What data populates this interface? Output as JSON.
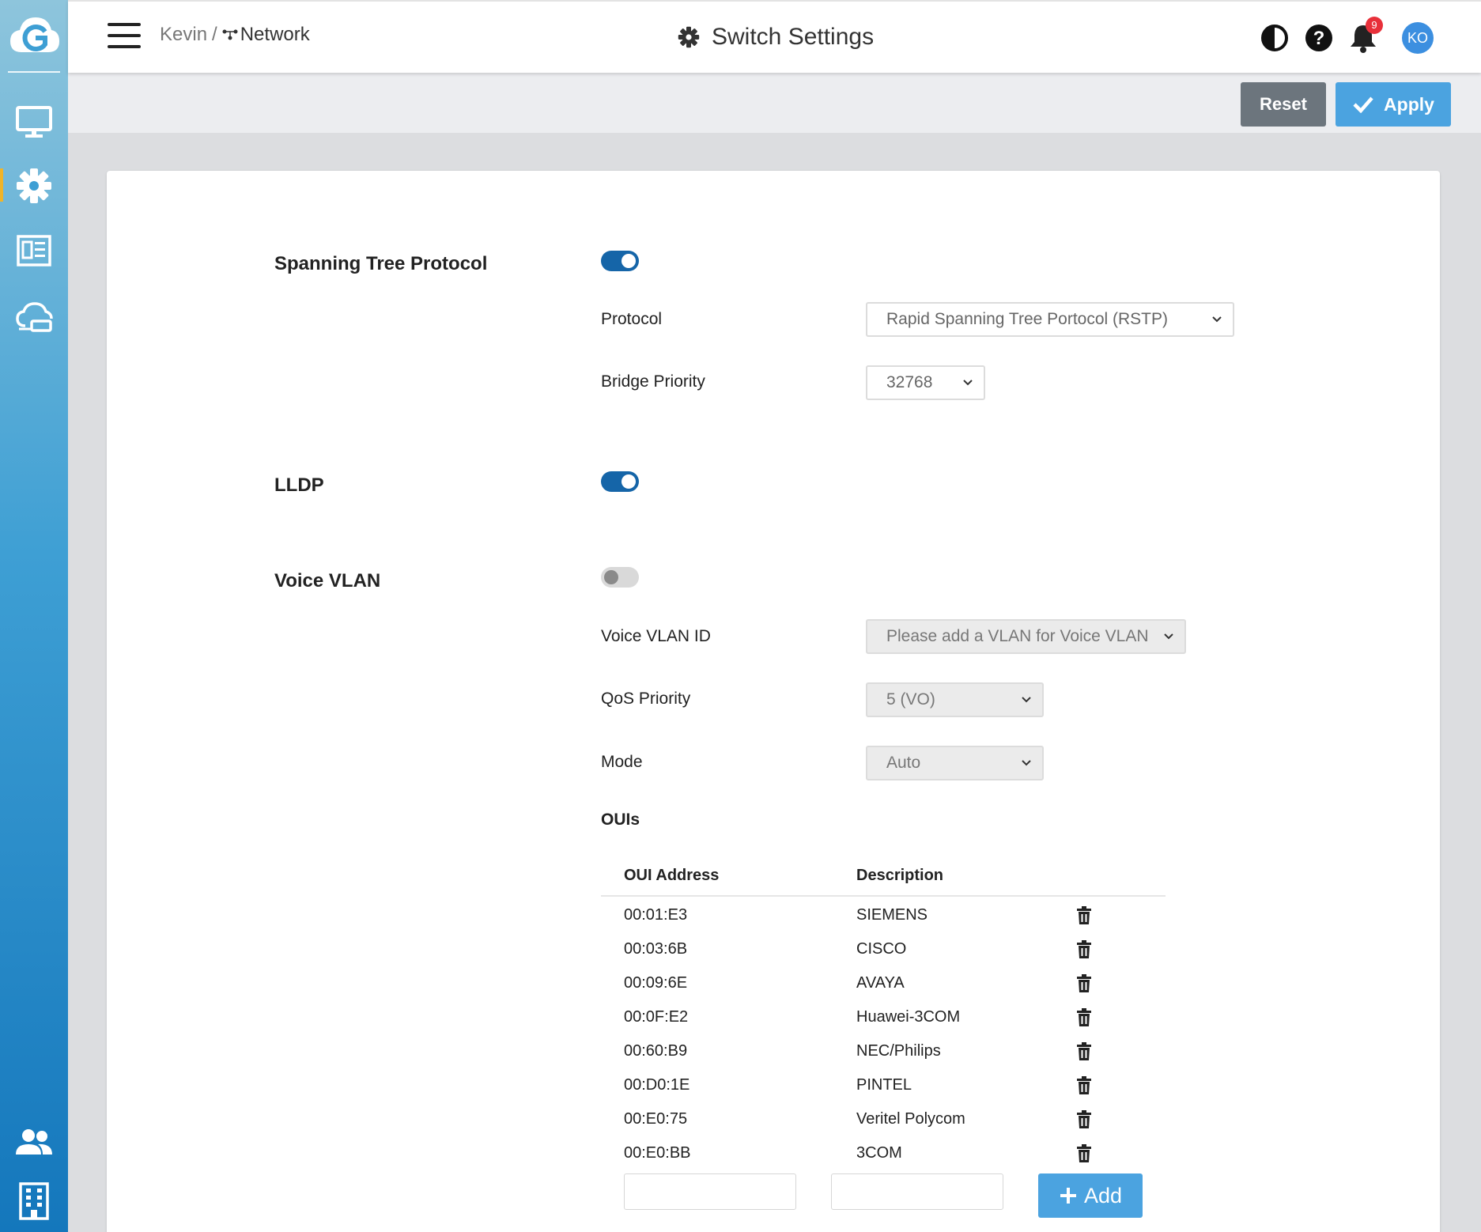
{
  "breadcrumb": {
    "parent": "Kevin",
    "separator": "/",
    "current": "Network"
  },
  "header": {
    "title": "Switch Settings",
    "notification_count": "9",
    "avatar_initials": "KO"
  },
  "actions": {
    "reset_label": "Reset",
    "apply_label": "Apply"
  },
  "stp": {
    "label": "Spanning Tree Protocol",
    "enabled": true,
    "protocol_label": "Protocol",
    "protocol_value": "Rapid Spanning Tree Portocol (RSTP)",
    "bridge_priority_label": "Bridge Priority",
    "bridge_priority_value": "32768"
  },
  "lldp": {
    "label": "LLDP",
    "enabled": true
  },
  "voice_vlan": {
    "label": "Voice VLAN",
    "enabled": false,
    "vlan_id_label": "Voice VLAN ID",
    "vlan_id_value": "Please add a VLAN for Voice VLAN",
    "qos_label": "QoS Priority",
    "qos_value": "5 (VO)",
    "mode_label": "Mode",
    "mode_value": "Auto",
    "ouis_label": "OUIs",
    "oui_columns": [
      "OUI Address",
      "Description"
    ],
    "ouis": [
      {
        "address": "00:01:E3",
        "description": "SIEMENS"
      },
      {
        "address": "00:03:6B",
        "description": "CISCO"
      },
      {
        "address": "00:09:6E",
        "description": "AVAYA"
      },
      {
        "address": "00:0F:E2",
        "description": "Huawei-3COM"
      },
      {
        "address": "00:60:B9",
        "description": "NEC/Philips"
      },
      {
        "address": "00:D0:1E",
        "description": "PINTEL"
      },
      {
        "address": "00:E0:75",
        "description": "Veritel Polycom"
      },
      {
        "address": "00:E0:BB",
        "description": "3COM"
      }
    ],
    "add_label": "Add"
  },
  "colors": {
    "primary": "#4ba3e0",
    "toggle_on": "#1565a8",
    "reset": "#6c757d",
    "badge": "#e8303a",
    "active_marker": "#f0b429"
  },
  "icons": [
    "logo-icon",
    "monitor-icon",
    "gear-icon",
    "newspaper-icon",
    "cloud-network-icon",
    "users-icon",
    "building-icon",
    "contrast-icon",
    "help-icon",
    "bell-icon",
    "trash-icon",
    "check-icon",
    "plus-icon",
    "network-icon",
    "chevron-down-icon"
  ]
}
